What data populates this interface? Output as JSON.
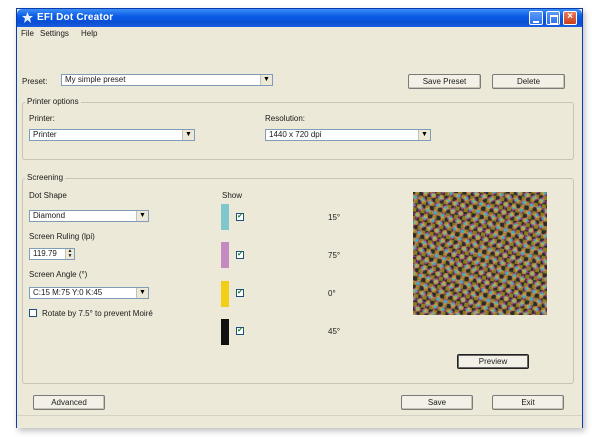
{
  "window": {
    "title": "EFI Dot Creator",
    "accent": "#0a4ed4",
    "close_color": "#c9401e"
  },
  "menu": {
    "items": [
      {
        "label": "File"
      },
      {
        "label": "Settings"
      },
      {
        "label": "Help"
      }
    ]
  },
  "preset": {
    "label": "Preset:",
    "value": "My simple preset",
    "save_label": "Save Preset",
    "delete_label": "Delete"
  },
  "printer_options": {
    "title": "Printer options",
    "printer_label": "Printer:",
    "printer_value": "Printer",
    "resolution_label": "Resolution:",
    "resolution_value": "1440 x 720 dpi"
  },
  "screening": {
    "title": "Screening",
    "dot_shape_label": "Dot Shape",
    "dot_shape_value": "Diamond",
    "ruling_label": "Screen Ruling (lpi)",
    "ruling_value": "119.79",
    "angle_label": "Screen Angle (°)",
    "angle_value": "C:15 M:75 Y:0 K:45",
    "rotate_label": "Rotate by 7.5° to prevent Moiré",
    "rotate_checked": false,
    "show_label": "Show",
    "channels": [
      {
        "color": "#7fc6cf",
        "checked": true,
        "angle": "15°"
      },
      {
        "color": "#c68ac3",
        "checked": true,
        "angle": "75°"
      },
      {
        "color": "#f2cf16",
        "checked": true,
        "angle": "0°"
      },
      {
        "color": "#111111",
        "checked": true,
        "angle": "45°"
      }
    ],
    "preview_label": "Preview"
  },
  "footer": {
    "advanced_label": "Advanced",
    "save_label": "Save",
    "exit_label": "Exit"
  }
}
